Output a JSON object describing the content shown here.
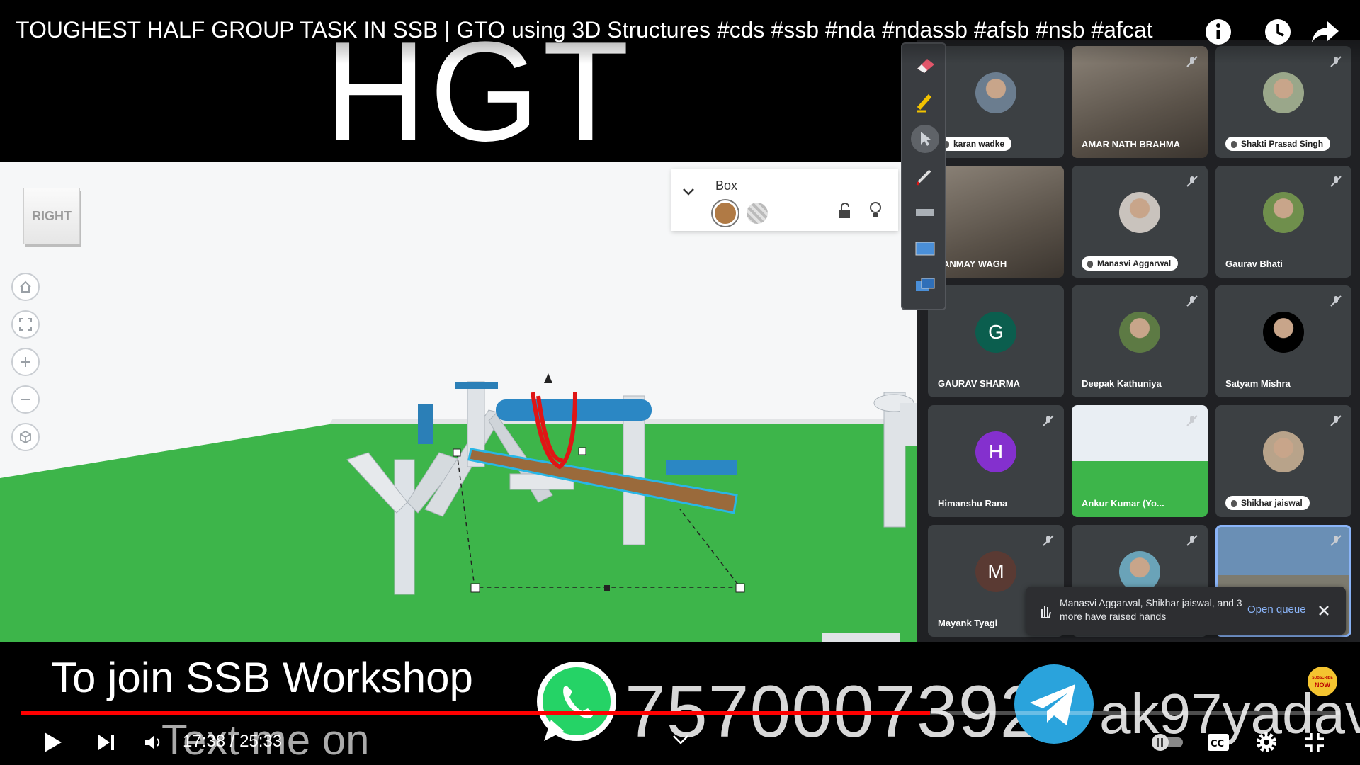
{
  "video": {
    "title": "TOUGHEST HALF GROUP TASK IN SSB | GTO using 3D Structures #cds #ssb #nda #ndassb #afsb #nsb #afcat",
    "overlay_heading": "HGT"
  },
  "scene": {
    "view_cube_label": "RIGHT",
    "shape_panel": {
      "label": "Box",
      "color_swatch": "#b07a45"
    }
  },
  "meet": {
    "participants": [
      {
        "name": "karan wadke",
        "kind": "photo",
        "color": "#6b7d8f"
      },
      {
        "name": "AMAR NATH BRAHMA",
        "kind": "video"
      },
      {
        "name": "Shakti Prasad Singh",
        "kind": "photo",
        "color": "#9aa78a"
      },
      {
        "name": "TANMAY WAGH",
        "kind": "video"
      },
      {
        "name": "Manasvi Aggarwal",
        "kind": "photo",
        "color": "#c9c3bd"
      },
      {
        "name": "Gaurav Bhati",
        "kind": "photo",
        "color": "#6f8f4c"
      },
      {
        "name": "GAURAV SHARMA",
        "kind": "initial",
        "initial": "G",
        "color": "#0b5e4e"
      },
      {
        "name": "Deepak Kathuniya",
        "kind": "photo",
        "color": "#5d7a44"
      },
      {
        "name": "Satyam Mishra",
        "kind": "photo",
        "color": "#000000"
      },
      {
        "name": "Himanshu Rana",
        "kind": "initial",
        "initial": "H",
        "color": "#8430ce"
      },
      {
        "name": "Ankur Kumar (Yo...",
        "kind": "screen"
      },
      {
        "name": "Shikhar jaiswal",
        "kind": "photo",
        "color": "#b8a38a"
      },
      {
        "name": "Mayank Tyagi",
        "kind": "initial",
        "initial": "M",
        "color": "#5a3a33"
      },
      {
        "name": "",
        "kind": "photo",
        "color": "#6aa3b8"
      },
      {
        "name": "",
        "kind": "video-active"
      }
    ],
    "raised_hands": {
      "message": "Manasvi Aggarwal, Shikhar jaiswal, and 3 more have raised hands",
      "action": "Open queue"
    }
  },
  "promo": {
    "line1": "To join SSB Workshop",
    "line2": "Text me on",
    "phone": "7570007392",
    "telegram": "ak97yadav",
    "badge_top": "SUBSCRIBE",
    "badge_bottom": "NOW"
  },
  "controls": {
    "time": "17:38 / 25:33",
    "progress_fraction": 0.689,
    "progress_color": "#ff0000"
  }
}
